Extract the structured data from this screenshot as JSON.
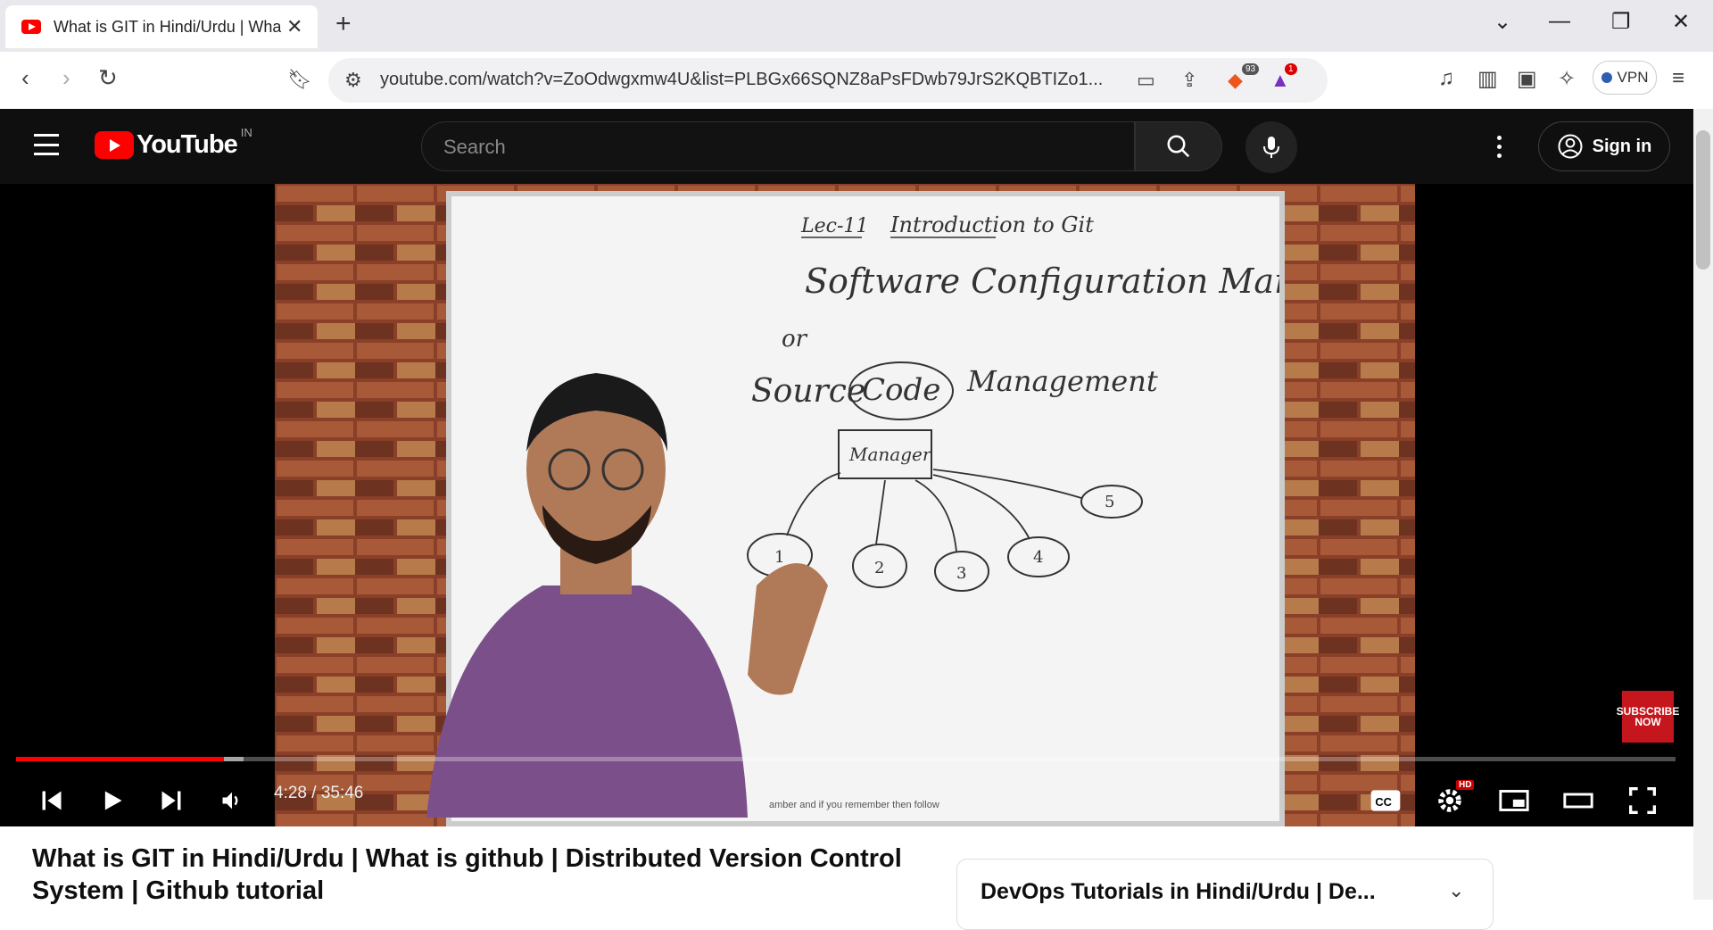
{
  "browser": {
    "tab_title": "What is GIT in Hindi/Urdu | What is github",
    "new_tab": "+",
    "url": "youtube.com/watch?v=ZoOdwgxmw4U&list=PLBGx66SQNZ8aPsFDwb79JrS2KQBTIZo1...",
    "brave_count": "93",
    "alert_count": "1",
    "vpn_label": "VPN"
  },
  "youtube": {
    "logo_text": "YouTube",
    "country_code": "IN",
    "search_placeholder": "Search",
    "sign_in": "Sign in"
  },
  "video": {
    "time": "4:28 / 35:46",
    "progress_fraction": 0.125,
    "buffered_fraction": 0.137,
    "settings_badge": "HD",
    "subscribe_badge": "SUBSCRIBE NOW",
    "caption_text": "amber and if you remember then follow",
    "board": {
      "lecture": "Lec-11",
      "heading": "Introduction to Git",
      "line1": "Software Configuration Management",
      "or": "or",
      "line2_a": "Source",
      "line2_b": "Code",
      "line2_c": "Management",
      "manager": "Manager",
      "nodes": [
        "1",
        "2",
        "3",
        "4",
        "5"
      ]
    }
  },
  "page": {
    "video_title": "What is GIT in Hindi/Urdu | What is github | Distributed Version Control System | Github tutorial",
    "playlist_title": "DevOps Tutorials in Hindi/Urdu | De..."
  },
  "colors": {
    "brand": "#ff0000",
    "header_bg": "#0f0f0f"
  }
}
